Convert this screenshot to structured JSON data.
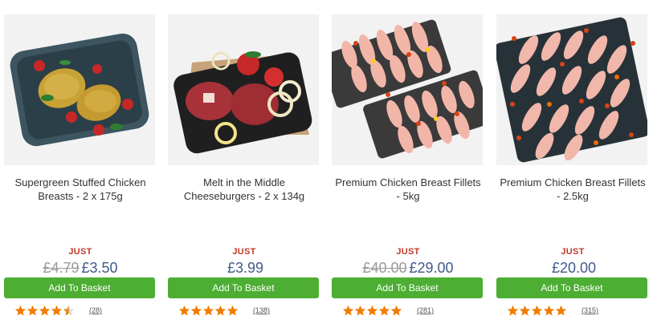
{
  "products": [
    {
      "title": "Supergreen Stuffed Chicken Breasts - 2 x 175g",
      "just_label": "JUST",
      "old_price": "£4.79",
      "price": "£3.50",
      "button_label": "Add To Basket",
      "rating": 4.5,
      "review_count": "(28)"
    },
    {
      "title": "Melt in the Middle Cheeseburgers - 2 x 134g",
      "just_label": "JUST",
      "old_price": "",
      "price": "£3.99",
      "button_label": "Add To Basket",
      "rating": 5,
      "review_count": "(138)"
    },
    {
      "title": "Premium Chicken Breast Fillets - 5kg",
      "just_label": "JUST",
      "old_price": "£40.00",
      "price": "£29.00",
      "button_label": "Add To Basket",
      "rating": 5,
      "review_count": "(281)"
    },
    {
      "title": "Premium Chicken Breast Fillets - 2.5kg",
      "just_label": "JUST",
      "old_price": "",
      "price": "£20.00",
      "button_label": "Add To Basket",
      "rating": 5,
      "review_count": "(315)"
    }
  ],
  "colors": {
    "button": "#4cae32",
    "price": "#3f5a8a",
    "just": "#c0392b",
    "star": "#f07c00"
  }
}
